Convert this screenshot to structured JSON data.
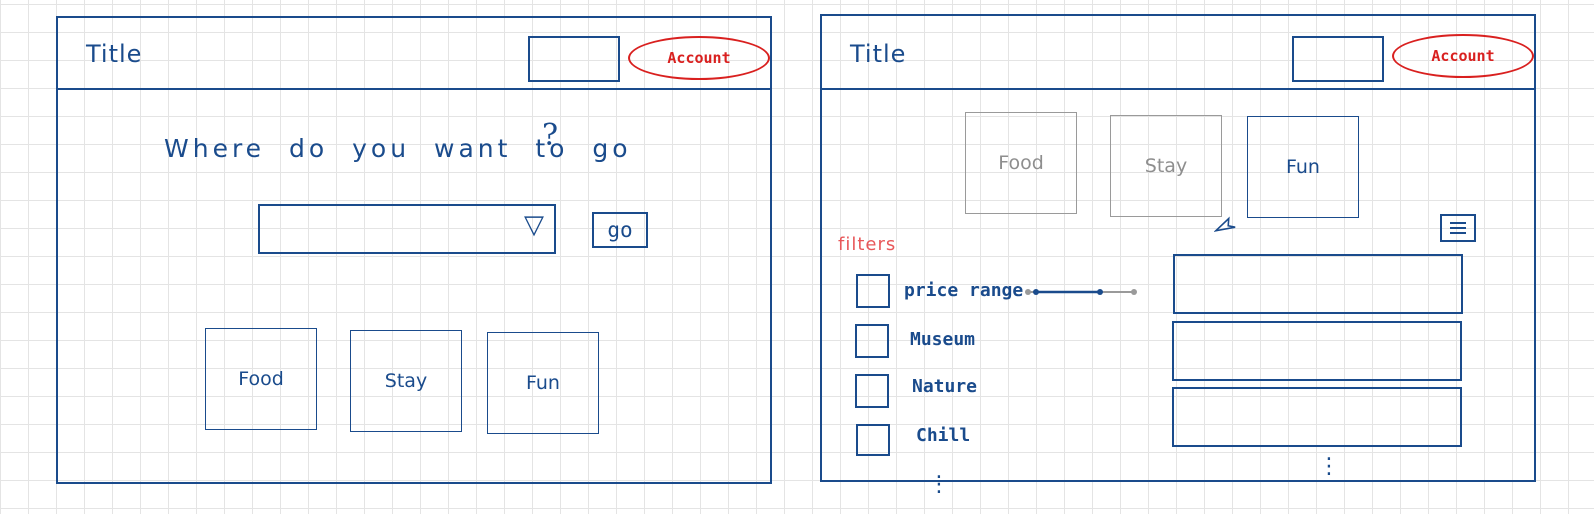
{
  "left_screen": {
    "header": {
      "title": "Title",
      "account_label": "Account"
    },
    "question": "Where do you want to go",
    "question_mark": "?",
    "dropdown": {
      "arrow": "▽"
    },
    "go_label": "go",
    "categories": [
      "Food",
      "Stay",
      "Fun"
    ]
  },
  "right_screen": {
    "header": {
      "title": "Title",
      "account_label": "Account"
    },
    "categories": [
      "Food",
      "Stay",
      "Fun"
    ],
    "filters": {
      "title": "filters",
      "items": [
        "price range",
        "Museum",
        "Nature",
        "Chill"
      ],
      "more": "⋮"
    },
    "results_more": "⋮",
    "icons": {
      "cursor": "pointer-icon",
      "menu": "list-icon"
    }
  },
  "colors": {
    "ink": "#1a4b8c",
    "account": "#d9201f",
    "filters": "#e8585a",
    "dim": "#9a9a9a"
  }
}
